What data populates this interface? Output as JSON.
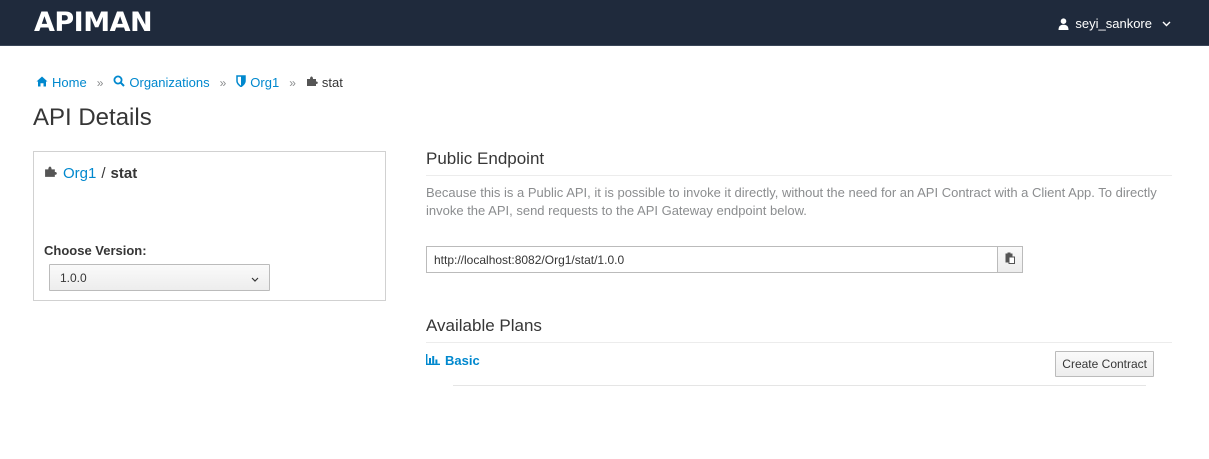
{
  "navbar": {
    "brand": "APIMAN",
    "user": "seyi_sankore"
  },
  "breadcrumb": {
    "home": "Home",
    "organizations": "Organizations",
    "org": "Org1",
    "current": "stat",
    "separator": "»"
  },
  "page_title": "API Details",
  "api_card": {
    "org": "Org1",
    "slash": "/",
    "api": "stat",
    "choose_version_label": "Choose Version:",
    "selected_version": "1.0.0"
  },
  "public_endpoint": {
    "title": "Public Endpoint",
    "description": "Because this is a Public API, it is possible to invoke it directly, without the need for an API Contract with a Client App. To directly invoke the API, send requests to the API Gateway endpoint below.",
    "url": "http://localhost:8082/Org1/stat/1.0.0"
  },
  "available_plans": {
    "title": "Available Plans",
    "plans": [
      {
        "name": "Basic",
        "action_label": "Create Contract"
      }
    ]
  },
  "colors": {
    "navbar_bg": "#1f2a3c",
    "link": "#0088ce",
    "text": "#363636",
    "muted": "#8b8d8f"
  },
  "icons": {
    "home": "home-icon",
    "organizations": "search-icon",
    "org": "shield-icon",
    "api": "puzzle-icon",
    "user": "user-icon",
    "copy": "clipboard-icon",
    "plan": "bar-chart-icon"
  }
}
